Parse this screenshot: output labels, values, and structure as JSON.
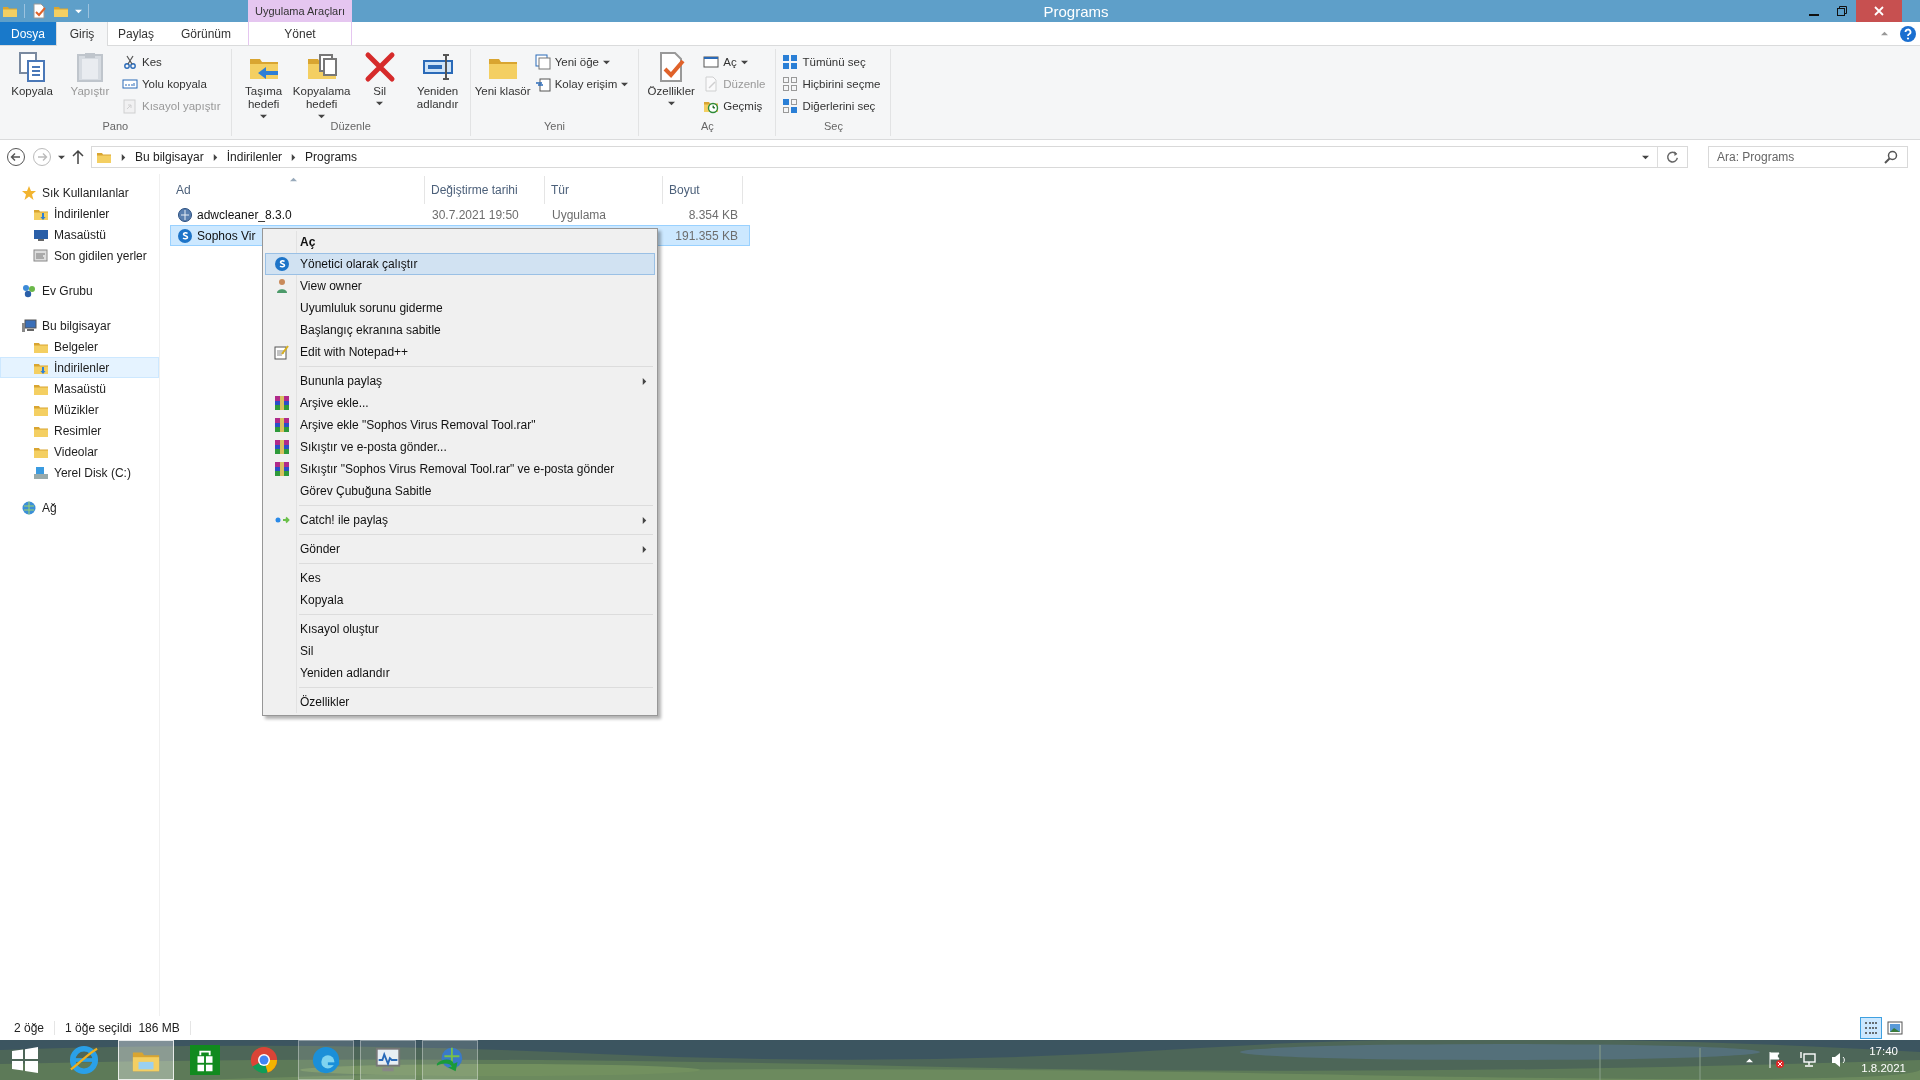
{
  "window": {
    "title": "Programs",
    "context_group": "Uygulama Araçları"
  },
  "ribbon_tabs": [
    {
      "label": "Dosya",
      "kind": "file",
      "selected": false
    },
    {
      "label": "Giriş",
      "kind": "tab",
      "selected": true
    },
    {
      "label": "Paylaş",
      "kind": "tab",
      "selected": false
    },
    {
      "label": "Görünüm",
      "kind": "tab",
      "selected": false
    },
    {
      "label": "Yönet",
      "kind": "context",
      "selected": false
    }
  ],
  "ribbon_groups": [
    {
      "label": "Pano",
      "items": [
        {
          "label": "Kopyala",
          "kind": "large",
          "disabled": false,
          "dropdown": false
        },
        {
          "label": "Yapıştır",
          "kind": "large",
          "disabled": true,
          "dropdown": false
        },
        {
          "kind": "stack",
          "items": [
            {
              "label": "Kes",
              "disabled": false,
              "dropdown": false
            },
            {
              "label": "Yolu kopyala",
              "disabled": false,
              "dropdown": false
            },
            {
              "label": "Kısayol yapıştır",
              "disabled": true,
              "dropdown": false
            }
          ]
        }
      ]
    },
    {
      "label": "Düzenle",
      "items": [
        {
          "label": "Taşıma hedefi",
          "kind": "large",
          "disabled": false,
          "dropdown": true
        },
        {
          "label": "Kopyalama hedefi",
          "kind": "large",
          "disabled": false,
          "dropdown": true
        },
        {
          "label": "Sil",
          "kind": "large",
          "disabled": false,
          "dropdown": true
        },
        {
          "label": "Yeniden adlandır",
          "kind": "large",
          "disabled": false,
          "dropdown": false
        }
      ]
    },
    {
      "label": "Yeni",
      "items": [
        {
          "label": "Yeni klasör",
          "kind": "large",
          "disabled": false,
          "dropdown": false
        },
        {
          "kind": "stack",
          "items": [
            {
              "label": "Yeni öğe",
              "disabled": false,
              "dropdown": true
            },
            {
              "label": "Kolay erişim",
              "disabled": false,
              "dropdown": true
            }
          ]
        }
      ]
    },
    {
      "label": "Aç",
      "items": [
        {
          "label": "Özellikler",
          "kind": "large",
          "disabled": false,
          "dropdown": true
        },
        {
          "kind": "stack",
          "items": [
            {
              "label": "Aç",
              "disabled": false,
              "dropdown": true
            },
            {
              "label": "Düzenle",
              "disabled": true,
              "dropdown": false
            },
            {
              "label": "Geçmiş",
              "disabled": false,
              "dropdown": false
            }
          ]
        }
      ]
    },
    {
      "label": "Seç",
      "items": [
        {
          "kind": "stack",
          "items": [
            {
              "label": "Tümünü seç",
              "disabled": false,
              "dropdown": false
            },
            {
              "label": "Hiçbirini seçme",
              "disabled": false,
              "dropdown": false
            },
            {
              "label": "Diğerlerini seç",
              "disabled": false,
              "dropdown": false
            }
          ]
        }
      ]
    }
  ],
  "address": {
    "breadcrumbs": [
      "Bu bilgisayar",
      "İndirilenler",
      "Programs"
    ],
    "search_placeholder": "Ara: Programs"
  },
  "sidebar": [
    {
      "label": "Sık Kullanılanlar",
      "kind": "star",
      "selected": false,
      "children": [
        {
          "label": "İndirilenler",
          "kind": "downloads",
          "selected": false
        },
        {
          "label": "Masaüstü",
          "kind": "desktop",
          "selected": false
        },
        {
          "label": "Son gidilen yerler",
          "kind": "recent",
          "selected": false
        }
      ]
    },
    {
      "label": "Ev Grubu",
      "kind": "homegroup",
      "selected": false
    },
    {
      "label": "Bu bilgisayar",
      "kind": "computer",
      "selected": false,
      "children": [
        {
          "label": "Belgeler",
          "kind": "folder",
          "selected": false
        },
        {
          "label": "İndirilenler",
          "kind": "downloads",
          "selected": true
        },
        {
          "label": "Masaüstü",
          "kind": "folder",
          "selected": false
        },
        {
          "label": "Müzikler",
          "kind": "folder",
          "selected": false
        },
        {
          "label": "Resimler",
          "kind": "folder",
          "selected": false
        },
        {
          "label": "Videolar",
          "kind": "folder",
          "selected": false
        },
        {
          "label": "Yerel Disk (C:)",
          "kind": "disk",
          "selected": false
        }
      ]
    },
    {
      "label": "Ağ",
      "kind": "network",
      "selected": false
    }
  ],
  "columns": [
    "Ad",
    "Değiştirme tarihi",
    "Tür",
    "Boyut"
  ],
  "files": [
    {
      "name": "adwcleaner_8.3.0",
      "date": "30.7.2021 19:50",
      "type": "Uygulama",
      "size": "8.354 KB",
      "kind": "globe",
      "selected": false
    },
    {
      "name": "Sophos Vir",
      "size": "191.355 KB",
      "kind": "shield",
      "selected": true
    }
  ],
  "context_menu": [
    [
      {
        "label": "Aç",
        "default": true,
        "kind": "plain",
        "submenu": false,
        "selected": false
      },
      {
        "label": "Yönetici olarak çalıştır",
        "default": false,
        "kind": "shield",
        "submenu": false,
        "selected": true
      },
      {
        "label": "View owner",
        "default": false,
        "kind": "person",
        "submenu": false,
        "selected": false
      },
      {
        "label": "Uyumluluk sorunu giderme",
        "default": false,
        "kind": "plain",
        "submenu": false,
        "selected": false
      },
      {
        "label": "Başlangıç ekranına sabitle",
        "default": false,
        "kind": "plain",
        "submenu": false,
        "selected": false
      },
      {
        "label": "Edit with Notepad++",
        "default": false,
        "kind": "notepad",
        "submenu": false,
        "selected": false
      }
    ],
    [
      {
        "label": "Bununla paylaş",
        "default": false,
        "kind": "plain",
        "submenu": true,
        "selected": false
      },
      {
        "label": "Arşive ekle...",
        "default": false,
        "kind": "archive",
        "submenu": false,
        "selected": false
      },
      {
        "label": "Arşive ekle \"Sophos Virus Removal Tool.rar\"",
        "default": false,
        "kind": "archive",
        "submenu": false,
        "selected": false
      },
      {
        "label": "Sıkıştır ve e-posta gönder...",
        "default": false,
        "kind": "archive",
        "submenu": false,
        "selected": false
      },
      {
        "label": "Sıkıştır \"Sophos Virus Removal Tool.rar\" ve e-posta gönder",
        "default": false,
        "kind": "archive",
        "submenu": false,
        "selected": false
      },
      {
        "label": "Görev Çubuğuna Sabitle",
        "default": false,
        "kind": "plain",
        "submenu": false,
        "selected": false
      }
    ],
    [
      {
        "label": "Catch! ile paylaş",
        "default": false,
        "kind": "share",
        "submenu": true,
        "selected": false
      }
    ],
    [
      {
        "label": "Gönder",
        "default": false,
        "kind": "plain",
        "submenu": true,
        "selected": false
      }
    ],
    [
      {
        "label": "Kes",
        "default": false,
        "kind": "plain",
        "submenu": false,
        "selected": false
      },
      {
        "label": "Kopyala",
        "default": false,
        "kind": "plain",
        "submenu": false,
        "selected": false
      }
    ],
    [
      {
        "label": "Kısayol oluştur",
        "default": false,
        "kind": "plain",
        "submenu": false,
        "selected": false
      },
      {
        "label": "Sil",
        "default": false,
        "kind": "plain",
        "submenu": false,
        "selected": false
      },
      {
        "label": "Yeniden adlandır",
        "default": false,
        "kind": "plain",
        "submenu": false,
        "selected": false
      }
    ],
    [
      {
        "label": "Özellikler",
        "default": false,
        "kind": "plain",
        "submenu": false,
        "selected": false
      }
    ]
  ],
  "status_bar": {
    "item_count": "2 öğe",
    "selection": "1 öğe seçildi  186 MB",
    "views": [
      {
        "kind": "details",
        "selected": true
      },
      {
        "kind": "thumbnails",
        "selected": false
      }
    ]
  },
  "taskbar": {
    "apps": [
      {
        "kind": "ie",
        "running": false,
        "selected": false
      },
      {
        "kind": "explorer",
        "running": true,
        "selected": true
      },
      {
        "kind": "store",
        "running": false,
        "selected": false
      },
      {
        "kind": "chrome",
        "running": false,
        "selected": false
      },
      {
        "kind": "edge",
        "running": true,
        "selected": false
      },
      {
        "kind": "perfmon",
        "running": true,
        "selected": false
      },
      {
        "kind": "idm",
        "running": true,
        "selected": false
      }
    ],
    "time": "17:40",
    "date": "1.8.2021"
  }
}
